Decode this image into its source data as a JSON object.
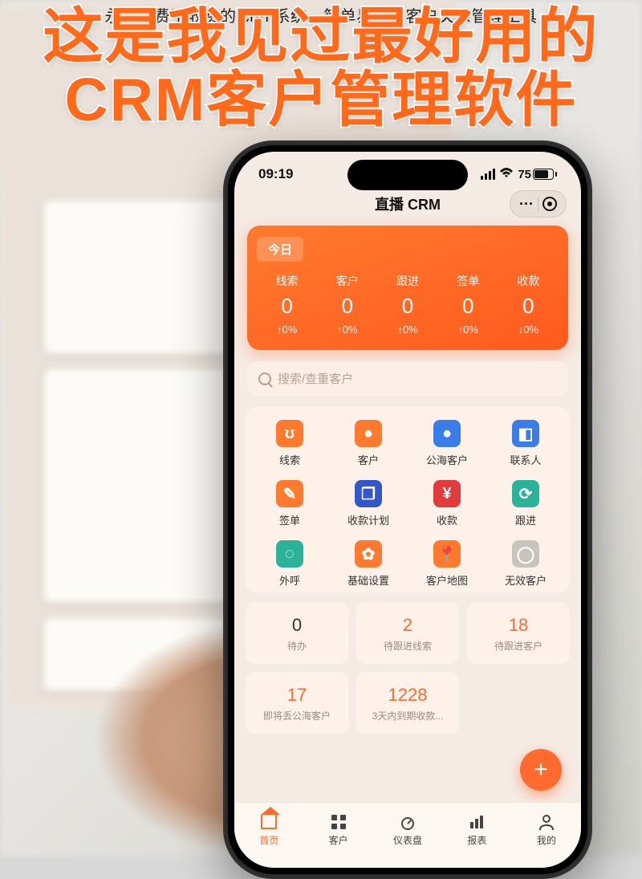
{
  "article_caption": "永久免费不收费的 crm 系统，简单易用的客户关系管理工具",
  "headline_l1": "这是我见过最好用的",
  "headline_l2": "CRM客户管理软件",
  "statusbar": {
    "time": "09:19",
    "battery": "75"
  },
  "app_title": "直播 CRM",
  "today": {
    "label": "今日",
    "cols": [
      {
        "label": "线索",
        "value": "0",
        "delta": "↑0%"
      },
      {
        "label": "客户",
        "value": "0",
        "delta": "↑0%"
      },
      {
        "label": "跟进",
        "value": "0",
        "delta": "↑0%"
      },
      {
        "label": "签单",
        "value": "0",
        "delta": "↑0%"
      },
      {
        "label": "收款",
        "value": "0",
        "delta": "↓0%"
      }
    ]
  },
  "search": {
    "placeholder": "搜索/查重客户"
  },
  "modules": [
    {
      "label": "线索",
      "glyph": "ʊ",
      "cls": "ic-orange"
    },
    {
      "label": "客户",
      "glyph": "●",
      "cls": "ic-orange"
    },
    {
      "label": "公海客户",
      "glyph": "●",
      "cls": "ic-blue"
    },
    {
      "label": "联系人",
      "glyph": "◧",
      "cls": "ic-blue"
    },
    {
      "label": "签单",
      "glyph": "✎",
      "cls": "ic-orange"
    },
    {
      "label": "收款计划",
      "glyph": "❒",
      "cls": "ic-blue2"
    },
    {
      "label": "收款",
      "glyph": "¥",
      "cls": "ic-red"
    },
    {
      "label": "跟进",
      "glyph": "⟳",
      "cls": "ic-teal"
    },
    {
      "label": "外呼",
      "glyph": "◌",
      "cls": "ic-teal"
    },
    {
      "label": "基础设置",
      "glyph": "✿",
      "cls": "ic-orange"
    },
    {
      "label": "客户地图",
      "glyph": "📍",
      "cls": "ic-orange"
    },
    {
      "label": "无效客户",
      "glyph": "◯",
      "cls": "ic-grey"
    }
  ],
  "stats": [
    {
      "value": "0",
      "label": "待办",
      "hot": false
    },
    {
      "value": "2",
      "label": "待跟进线索",
      "hot": true
    },
    {
      "value": "18",
      "label": "待跟进客户",
      "hot": true
    },
    {
      "value": "17",
      "label": "即将丢公海客户",
      "hot": true
    },
    {
      "value": "1228",
      "label": "3天内到期收款...",
      "hot": true
    }
  ],
  "tabs": [
    {
      "label": "首页",
      "icon": "home",
      "active": true
    },
    {
      "label": "客户",
      "icon": "grid",
      "active": false
    },
    {
      "label": "仪表盘",
      "icon": "dash",
      "active": false
    },
    {
      "label": "报表",
      "icon": "report",
      "active": false
    },
    {
      "label": "我的",
      "icon": "user",
      "active": false
    }
  ]
}
